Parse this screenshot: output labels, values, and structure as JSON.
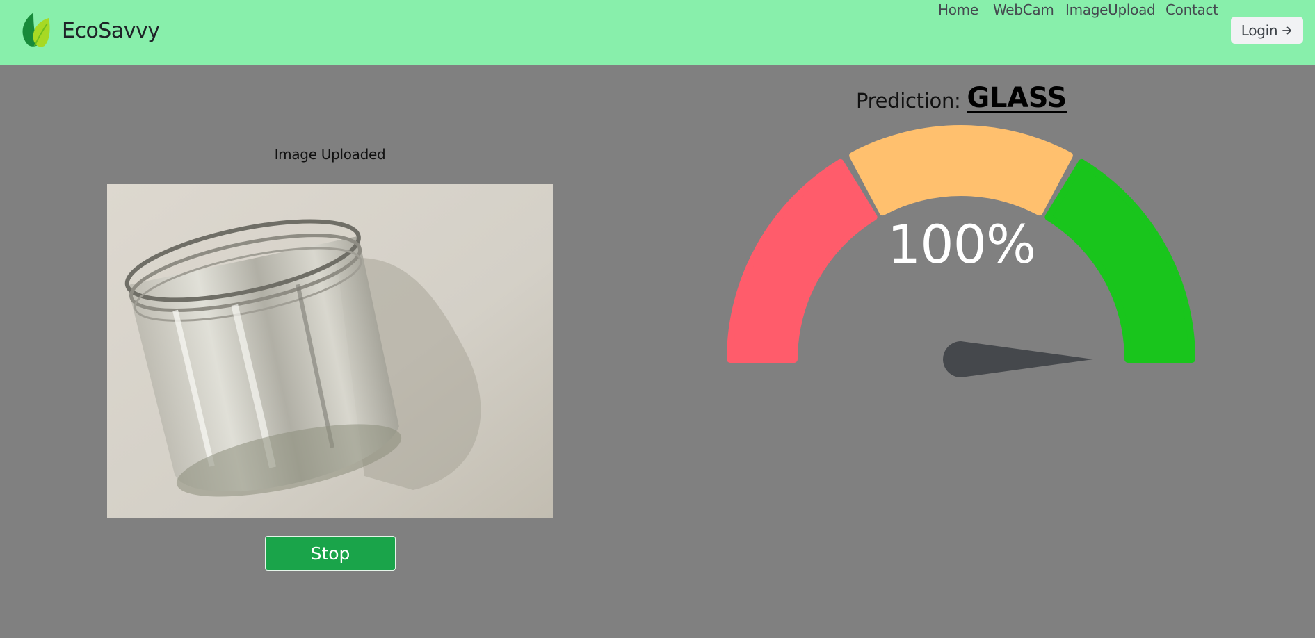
{
  "navbar": {
    "brand_name": "EcoSavvy",
    "logo_icon": "leaf-icon",
    "links": [
      {
        "label": "Home",
        "name": "nav-link-home"
      },
      {
        "label": "WebCam",
        "name": "nav-link-webcam"
      },
      {
        "label": "ImageUpload",
        "name": "nav-link-imageupload"
      },
      {
        "label": "Contact",
        "name": "nav-link-contact"
      }
    ],
    "login_label": "Login",
    "login_icon": "arrow-right-icon"
  },
  "upload": {
    "caption": "Image Uploaded",
    "stop_label": "Stop"
  },
  "prediction": {
    "label": "Prediction:",
    "value": "GLASS",
    "confidence_text": "100%",
    "confidence": 1.0
  },
  "gauge": {
    "segments": [
      {
        "name": "low",
        "color": "#ff5c6b"
      },
      {
        "name": "medium",
        "color": "#ffc06e"
      },
      {
        "name": "high",
        "color": "#19c51c"
      }
    ],
    "needle_color": "#45484c"
  },
  "colors": {
    "navbar_bg": "#88efab",
    "page_bg": "#808080",
    "stop_button": "#1aa44a"
  }
}
